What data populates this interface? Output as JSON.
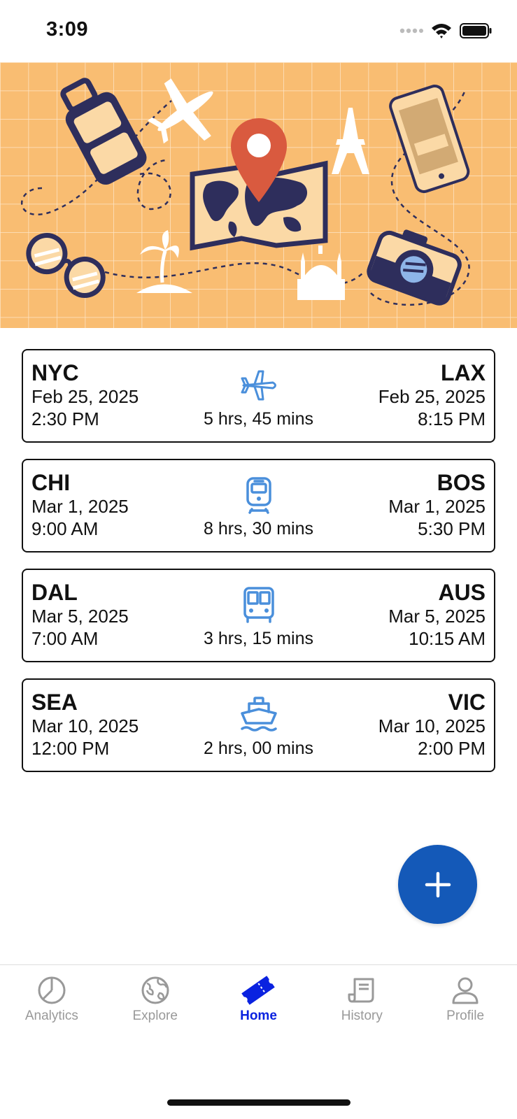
{
  "status": {
    "time": "3:09"
  },
  "trips": [
    {
      "mode": "plane",
      "from": {
        "code": "NYC",
        "date": "Feb 25, 2025",
        "time": "2:30 PM"
      },
      "to": {
        "code": "LAX",
        "date": "Feb 25, 2025",
        "time": "8:15 PM"
      },
      "duration": "5 hrs, 45 mins"
    },
    {
      "mode": "train",
      "from": {
        "code": "CHI",
        "date": "Mar 1, 2025",
        "time": "9:00 AM"
      },
      "to": {
        "code": "BOS",
        "date": "Mar 1, 2025",
        "time": "5:30 PM"
      },
      "duration": "8 hrs, 30 mins"
    },
    {
      "mode": "bus",
      "from": {
        "code": "DAL",
        "date": "Mar 5, 2025",
        "time": "7:00 AM"
      },
      "to": {
        "code": "AUS",
        "date": "Mar 5, 2025",
        "time": "10:15 AM"
      },
      "duration": "3 hrs, 15 mins"
    },
    {
      "mode": "ship",
      "from": {
        "code": "SEA",
        "date": "Mar 10, 2025",
        "time": "12:00 PM"
      },
      "to": {
        "code": "VIC",
        "date": "Mar 10, 2025",
        "time": "2:00 PM"
      },
      "duration": "2 hrs, 00 mins"
    }
  ],
  "fab": {
    "icon": "plus-icon"
  },
  "tabs": [
    {
      "label": "Analytics",
      "icon": "pie-chart-icon",
      "active": false
    },
    {
      "label": "Explore",
      "icon": "globe-icon",
      "active": false
    },
    {
      "label": "Home",
      "icon": "ticket-icon",
      "active": true
    },
    {
      "label": "History",
      "icon": "receipt-icon",
      "active": false
    },
    {
      "label": "Profile",
      "icon": "person-icon",
      "active": false
    }
  ],
  "colors": {
    "hero_bg": "#f9bd72",
    "accent_blue": "#1459b8",
    "transport_icon": "#4a8fdb",
    "tab_active": "#0a22e0",
    "tab_inactive": "#999999",
    "illustration_navy": "#2e2e5c",
    "pin_red": "#d95a3f"
  }
}
